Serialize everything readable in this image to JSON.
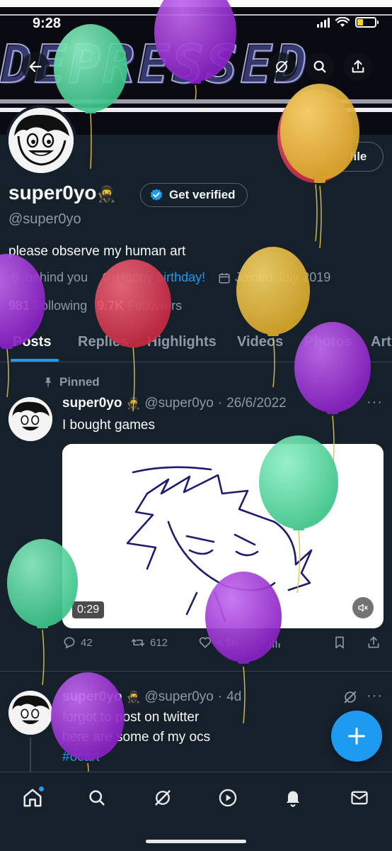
{
  "status_bar": {
    "time": "9:28",
    "battery_level": 0.35
  },
  "colors": {
    "background": "#15202b",
    "accent": "#1d9bf0",
    "muted_text": "#8b98a5",
    "balloon_green": "#4fd39a",
    "balloon_purple": "#9b2fd1",
    "balloon_yellow": "#e8b83a",
    "balloon_red": "#d9384f"
  },
  "header": {
    "back_icon": "arrow-left-icon",
    "grok_icon": "grok-slash-circle-icon",
    "search_icon": "search-icon",
    "share_icon": "share-icon"
  },
  "profile": {
    "display_name": "super0yo",
    "name_emoji": "🥷",
    "get_verified_label": "Get verified",
    "edit_profile_label": "Edit profile",
    "handle": "@super0yo",
    "bio": "please observe my human art",
    "location": "behind you",
    "birthday": "Happy birthday!",
    "joined": "Joined July 2019",
    "following_count": "981",
    "following_label": "Following",
    "followers_count": "9.7K",
    "followers_label": "Followers"
  },
  "tabs": [
    {
      "label": "Posts",
      "active": true
    },
    {
      "label": "Replies",
      "active": false
    },
    {
      "label": "Highlights",
      "active": false
    },
    {
      "label": "Videos",
      "active": false
    },
    {
      "label": "Photos",
      "active": false
    },
    {
      "label": "Art",
      "active": false
    }
  ],
  "posts": [
    {
      "pinned_label": "Pinned",
      "author": "super0yo",
      "emoji": "🥷",
      "handle": "@super0yo",
      "sep": "·",
      "date": "26/6/2022",
      "text": "I bought games",
      "video_duration": "0:29",
      "replies": "42",
      "reposts": "612",
      "likes": "4.5K"
    },
    {
      "author": "super0yo",
      "emoji": "🥷",
      "handle": "@super0yo",
      "sep": "·",
      "date": "4d",
      "line1": "forgot to post on twitter",
      "line2": "here are some of my ocs",
      "hashtag": "#ocart"
    }
  ],
  "fab": {
    "icon": "plus-icon"
  },
  "bottom_nav": [
    "home-icon",
    "search-icon",
    "grok-icon",
    "play-icon",
    "bell-icon",
    "mail-icon"
  ]
}
